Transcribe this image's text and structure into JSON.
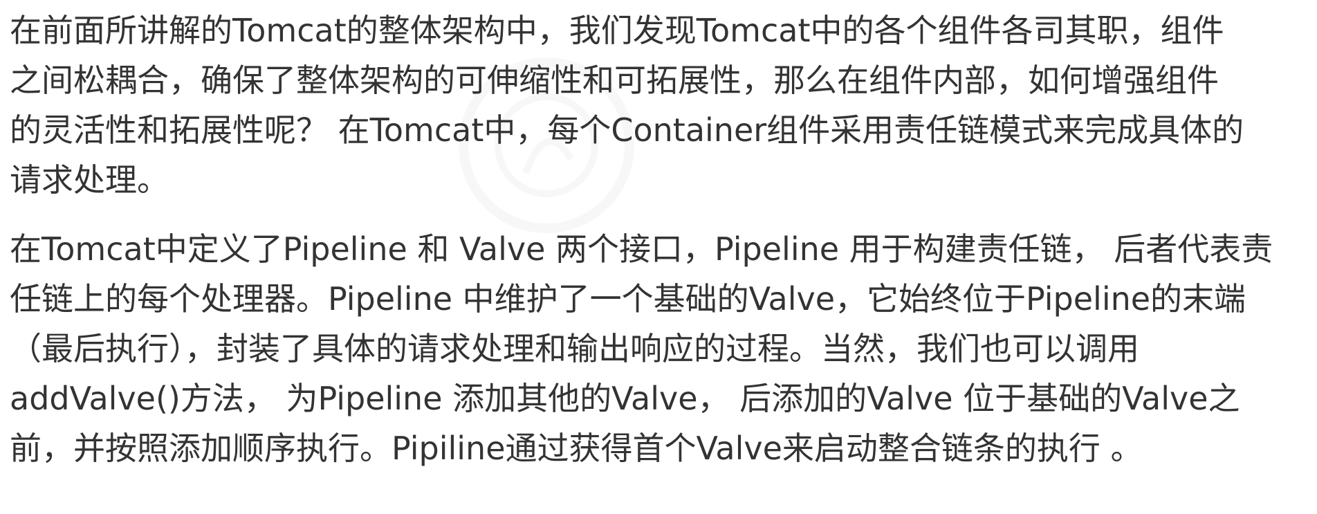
{
  "paragraphs": [
    {
      "lines": [
        "在前面所讲解的Tomcat的整体架构中，我们发现Tomcat中的各个组件各司其职，组件",
        "之间松耦合，确保了整体架构的可伸缩性和可拓展性，那么在组件内部，如何增强组件",
        "的灵活性和拓展性呢？ 在Tomcat中，每个Container组件采用责任链模式来完成具体的",
        "请求处理。"
      ]
    },
    {
      "lines": [
        "在Tomcat中定义了Pipeline 和 Valve 两个接口，Pipeline 用于构建责任链， 后者代表责",
        "任链上的每个处理器。Pipeline 中维护了一个基础的Valve，它始终位于Pipeline的末端",
        "（最后执行），封装了具体的请求处理和输出响应的过程。当然，我们也可以调用",
        "addValve()方法， 为Pipeline 添加其他的Valve， 后添加的Valve 位于基础的Valve之",
        "前，并按照添加顺序执行。Pipiline通过获得首个Valve来启动整合链条的执行 。"
      ]
    }
  ],
  "watermark_icon": "circular-logo-watermark"
}
